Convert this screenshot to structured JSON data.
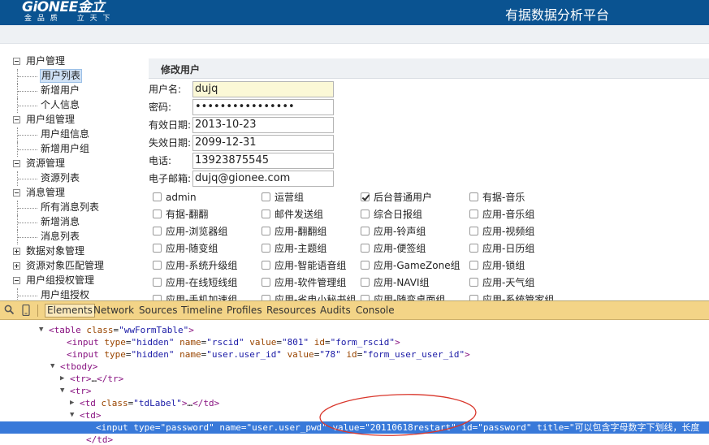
{
  "header": {
    "logo_text": "GiONEE金立",
    "logo_sub": "金 品 质　　立 天 下",
    "platform_title": "有据数据分析平台"
  },
  "tree": [
    {
      "kind": "top",
      "label": "用户管理",
      "expander": "minus"
    },
    {
      "kind": "child",
      "label": "用户列表",
      "selected": true
    },
    {
      "kind": "child",
      "label": "新增用户"
    },
    {
      "kind": "child",
      "label": "个人信息"
    },
    {
      "kind": "top",
      "label": "用户组管理",
      "expander": "minus"
    },
    {
      "kind": "child",
      "label": "用户组信息"
    },
    {
      "kind": "child",
      "label": "新增用户组"
    },
    {
      "kind": "top",
      "label": "资源管理",
      "expander": "minus"
    },
    {
      "kind": "child",
      "label": "资源列表"
    },
    {
      "kind": "top",
      "label": "消息管理",
      "expander": "minus"
    },
    {
      "kind": "child",
      "label": "所有消息列表"
    },
    {
      "kind": "child",
      "label": "新增消息"
    },
    {
      "kind": "child",
      "label": "消息列表"
    },
    {
      "kind": "top",
      "label": "数据对象管理",
      "expander": "plus"
    },
    {
      "kind": "top",
      "label": "资源对象匹配管理",
      "expander": "plus"
    },
    {
      "kind": "top",
      "label": "用户组授权管理",
      "expander": "minus"
    },
    {
      "kind": "child",
      "label": "用户组授权"
    }
  ],
  "form": {
    "title": "修改用户",
    "fields": [
      {
        "label": "用户名:",
        "value": "dujq",
        "highlight": true
      },
      {
        "label": "密码:",
        "value": "••••••••••••••••",
        "highlight": false
      },
      {
        "label": "有效日期:",
        "value": "2013-10-23",
        "highlight": false
      },
      {
        "label": "失效日期:",
        "value": "2099-12-31",
        "highlight": false
      },
      {
        "label": "电话:",
        "value": "13923875545",
        "highlight": false
      },
      {
        "label": "电子邮箱:",
        "value": "dujq@gionee.com",
        "highlight": false
      }
    ],
    "groups": [
      [
        {
          "label": "admin",
          "checked": false
        },
        {
          "label": "运营组",
          "checked": false
        },
        {
          "label": "后台普通用户",
          "checked": true
        },
        {
          "label": "有据-音乐",
          "checked": false
        }
      ],
      [
        {
          "label": "有据-翻翻",
          "checked": false
        },
        {
          "label": "邮件发送组",
          "checked": false
        },
        {
          "label": "综合日报组",
          "checked": false
        },
        {
          "label": "应用-音乐组",
          "checked": false
        }
      ],
      [
        {
          "label": "应用-浏览器组",
          "checked": false
        },
        {
          "label": "应用-翻翻组",
          "checked": false
        },
        {
          "label": "应用-铃声组",
          "checked": false
        },
        {
          "label": "应用-视频组",
          "checked": false
        }
      ],
      [
        {
          "label": "应用-随变组",
          "checked": false
        },
        {
          "label": "应用-主题组",
          "checked": false
        },
        {
          "label": "应用-便签组",
          "checked": false
        },
        {
          "label": "应用-日历组",
          "checked": false
        }
      ],
      [
        {
          "label": "应用-系统升级组",
          "checked": false
        },
        {
          "label": "应用-智能语音组",
          "checked": false
        },
        {
          "label": "应用-GameZone组",
          "checked": false
        },
        {
          "label": "应用-锁组",
          "checked": false
        }
      ],
      [
        {
          "label": "应用-在线短线组",
          "checked": false
        },
        {
          "label": "应用-软件管理组",
          "checked": false
        },
        {
          "label": "应用-NAVI组",
          "checked": false
        },
        {
          "label": "应用-天气组",
          "checked": false
        }
      ],
      [
        {
          "label": "应用-手机加速组",
          "checked": false
        },
        {
          "label": "应用-省电小秘书组",
          "checked": false
        },
        {
          "label": "应用-随变桌面组",
          "checked": false
        },
        {
          "label": "应用-系统管家组",
          "checked": false
        }
      ]
    ]
  },
  "devtools": {
    "tabs": [
      "Elements",
      "Network",
      "Sources",
      "Timeline",
      "Profiles",
      "Resources",
      "Audits",
      "Console"
    ],
    "active_tab": "Elements",
    "lines": [
      {
        "indent": 60,
        "tri": "▼",
        "selected": false,
        "tokens": [
          [
            "tg",
            "<table "
          ],
          [
            "an",
            "class"
          ],
          [
            "tx",
            "="
          ],
          [
            "av",
            "\"wwFormTable\""
          ],
          [
            "tg",
            ">"
          ]
        ]
      },
      {
        "indent": 82,
        "tri": "",
        "selected": false,
        "tokens": [
          [
            "tg",
            "<input "
          ],
          [
            "an",
            "type"
          ],
          [
            "tx",
            "="
          ],
          [
            "av",
            "\"hidden\" "
          ],
          [
            "an",
            "name"
          ],
          [
            "tx",
            "="
          ],
          [
            "av",
            "\"rscid\" "
          ],
          [
            "an",
            "value"
          ],
          [
            "tx",
            "="
          ],
          [
            "av",
            "\"801\" "
          ],
          [
            "an",
            "id"
          ],
          [
            "tx",
            "="
          ],
          [
            "av",
            "\"form_rscid\""
          ],
          [
            "tg",
            ">"
          ]
        ]
      },
      {
        "indent": 82,
        "tri": "",
        "selected": false,
        "tokens": [
          [
            "tg",
            "<input "
          ],
          [
            "an",
            "type"
          ],
          [
            "tx",
            "="
          ],
          [
            "av",
            "\"hidden\" "
          ],
          [
            "an",
            "name"
          ],
          [
            "tx",
            "="
          ],
          [
            "av",
            "\"user.user_id\" "
          ],
          [
            "an",
            "value"
          ],
          [
            "tx",
            "="
          ],
          [
            "av",
            "\"78\" "
          ],
          [
            "an",
            "id"
          ],
          [
            "tx",
            "="
          ],
          [
            "av",
            "\"form_user_user_id\""
          ],
          [
            "tg",
            ">"
          ]
        ]
      },
      {
        "indent": 74,
        "tri": "▼",
        "selected": false,
        "tokens": [
          [
            "tg",
            "<tbody>"
          ]
        ]
      },
      {
        "indent": 86,
        "tri": "▶",
        "selected": false,
        "tokens": [
          [
            "tg",
            "<tr>"
          ],
          [
            "tx",
            "…"
          ],
          [
            "tg",
            "</tr>"
          ]
        ]
      },
      {
        "indent": 86,
        "tri": "▼",
        "selected": false,
        "tokens": [
          [
            "tg",
            "<tr>"
          ]
        ]
      },
      {
        "indent": 98,
        "tri": "▶",
        "selected": false,
        "tokens": [
          [
            "tg",
            "<td "
          ],
          [
            "an",
            "class"
          ],
          [
            "tx",
            "="
          ],
          [
            "av",
            "\"tdLabel\""
          ],
          [
            "tg",
            ">"
          ],
          [
            "tx",
            "…"
          ],
          [
            "tg",
            "</td>"
          ]
        ]
      },
      {
        "indent": 98,
        "tri": "▼",
        "selected": false,
        "tokens": [
          [
            "tg",
            "<td>"
          ]
        ]
      },
      {
        "indent": 118,
        "tri": "",
        "selected": true,
        "tokens": [
          [
            "tg",
            "<input "
          ],
          [
            "an",
            "type"
          ],
          [
            "tx",
            "="
          ],
          [
            "av",
            "\"password\" "
          ],
          [
            "an",
            "name"
          ],
          [
            "tx",
            "="
          ],
          [
            "av",
            "\"user.user_pwd\" "
          ],
          [
            "an",
            "value"
          ],
          [
            "tx",
            "="
          ],
          [
            "av",
            "\"20110618restart\" "
          ],
          [
            "an",
            "id"
          ],
          [
            "tx",
            "="
          ],
          [
            "av",
            "\"password\" "
          ],
          [
            "an",
            "title"
          ],
          [
            "tx",
            "="
          ],
          [
            "av",
            "\"可以包含字母数字下划线，长度"
          ]
        ]
      },
      {
        "indent": 106,
        "tri": "",
        "selected": false,
        "tokens": [
          [
            "tg",
            "</td>"
          ]
        ]
      }
    ]
  },
  "colors": {
    "header_bg": "#0a5391",
    "devtools_toolbar": "#f3d487",
    "selected_line": "#3879d9",
    "annotation": "#d9362b"
  }
}
